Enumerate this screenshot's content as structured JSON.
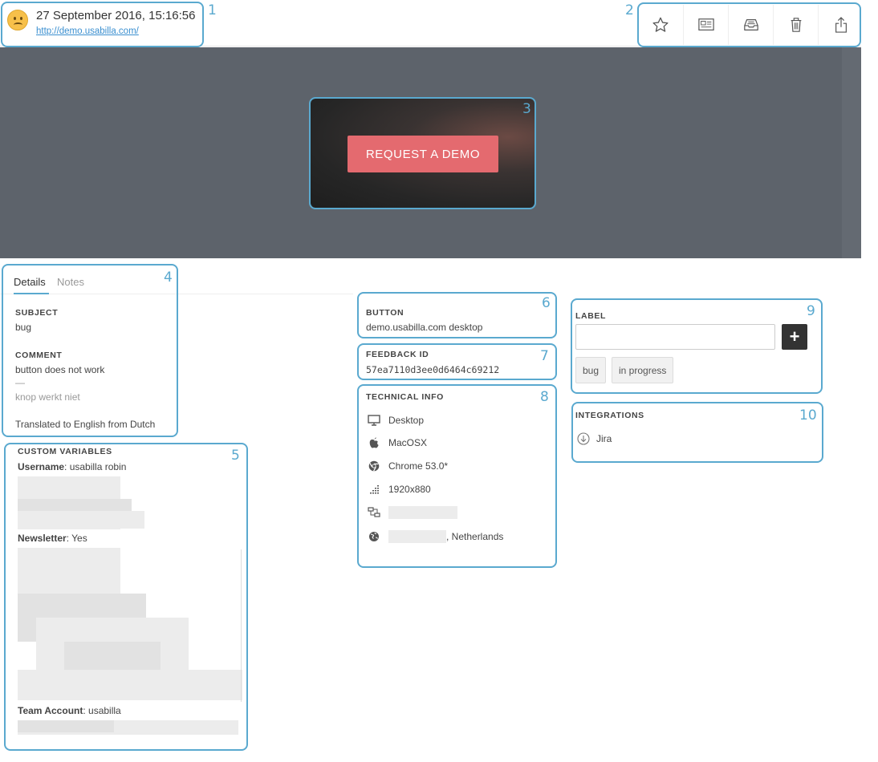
{
  "header": {
    "timestamp": "27 September 2016, 15:16:56",
    "url": "http://demo.usabilla.com/",
    "mood_icon": "sad-face-icon",
    "toolbar": [
      "star-icon",
      "newspaper-icon",
      "inbox-icon",
      "trash-icon",
      "share-icon"
    ]
  },
  "screenshot": {
    "button_label": "REQUEST A DEMO"
  },
  "tabs": {
    "details": "Details",
    "notes": "Notes"
  },
  "details": {
    "subject_label": "SUBJECT",
    "subject_value": "bug",
    "comment_label": "COMMENT",
    "comment_value": "button does not work",
    "dash": "—",
    "original_text": "knop werkt niet",
    "translation_note": "Translated to English from Dutch"
  },
  "custom_variables": {
    "title": "CUSTOM VARIABLES",
    "username_key": "Username",
    "username_value": ": usabilla robin",
    "newsletter_key": "Newsletter",
    "newsletter_value": ": Yes",
    "team_key": "Team Account",
    "team_value": ": usabilla"
  },
  "button_info": {
    "label": "BUTTON",
    "value": "demo.usabilla.com desktop"
  },
  "feedback": {
    "label": "FEEDBACK ID",
    "value": "57ea7110d3ee0d6464c69212"
  },
  "technical": {
    "title": "TECHNICAL INFO",
    "device": "Desktop",
    "os": "MacOSX",
    "browser": "Chrome 53.0*",
    "resolution": "1920x880",
    "location_suffix": ", Netherlands"
  },
  "label_panel": {
    "title": "LABEL",
    "tags": [
      "bug",
      "in progress"
    ]
  },
  "integrations": {
    "title": "INTEGRATIONS",
    "item": "Jira"
  },
  "callouts": [
    "1",
    "2",
    "3",
    "4",
    "5",
    "6",
    "7",
    "8",
    "9",
    "10"
  ]
}
